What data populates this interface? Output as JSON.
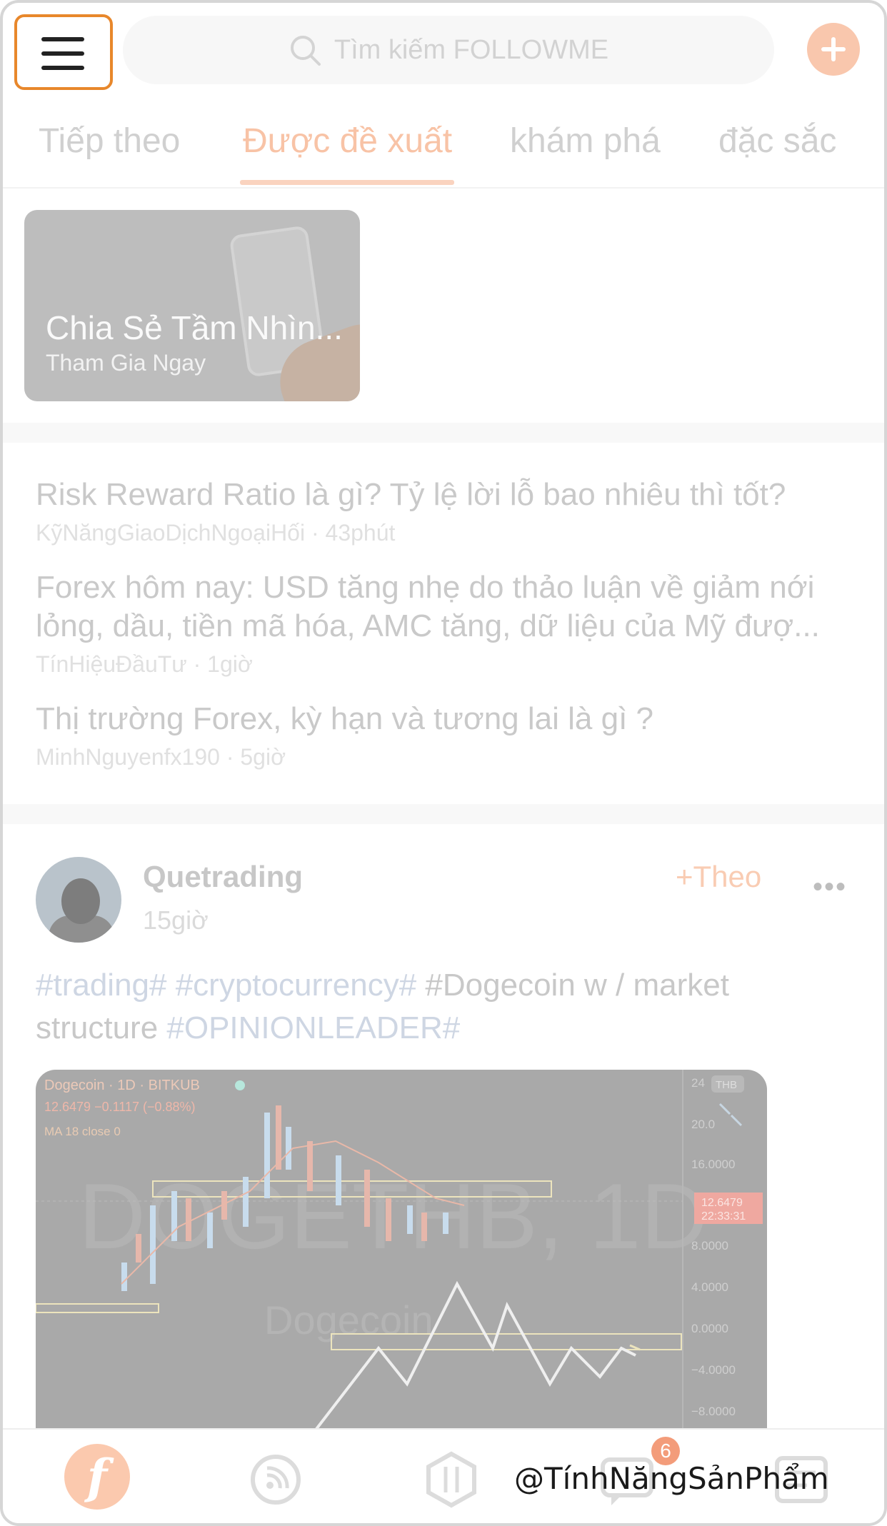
{
  "header": {
    "search_placeholder": "Tìm kiếm FOLLOWME"
  },
  "tabs": [
    {
      "label": "Tiếp theo",
      "active": false
    },
    {
      "label": "Được đề xuất",
      "active": true
    },
    {
      "label": "khám phá",
      "active": false
    },
    {
      "label": "đặc sắc",
      "active": false
    }
  ],
  "banner": {
    "title": "Chia Sẻ Tầm Nhìn...",
    "subtitle": "Tham Gia Ngay"
  },
  "articles": [
    {
      "title": "Risk Reward Ratio là gì? Tỷ lệ lời lỗ bao nhiêu thì tốt?",
      "author": "KỹNăngGiaoDịchNgoạiHối",
      "time": "43phút"
    },
    {
      "title_line1": "Forex hôm nay: USD tăng nhẹ do thảo luận về giảm nới",
      "title_line2": "lỏng, dầu, tiền mã hóa, AMC tăng, dữ liệu của Mỹ đượ...",
      "author": "TínHiệuĐầuTư",
      "time": "1giờ"
    },
    {
      "title": "Thị trường Forex, kỳ hạn và tương lai là gì ?",
      "author": "MinhNguyenfx190",
      "time": "5giờ"
    }
  ],
  "post": {
    "author": "Quetrading",
    "time": "15giờ",
    "follow_label": "+Theo",
    "more_label": "•••",
    "tags_line1": "#trading# #cryptocurrency#",
    "text_line1": " #Dogecoin w / market",
    "text_line2_plain": "structure ",
    "tags_line2": "#OPINIONLEADER#",
    "chart": {
      "symbol_line": "Dogecoin · 1D · BITKUB",
      "price_line": "12.6479 −0.1117 (−0.88%)",
      "ma_line": "MA 18 close 0",
      "currency": "THB",
      "watermark_main": "DOGETHB, 1D",
      "watermark_sub": "Dogecoin",
      "price_tag": "12.6479",
      "price_time": "22:33:31",
      "axis_labels": [
        "24",
        "20.0",
        "16.0000",
        "8.0000",
        "4.0000",
        "0.0000",
        "−4.0000",
        "−8.0000"
      ]
    }
  },
  "bottom_nav": {
    "logo_letter": "f",
    "badge_count": "6",
    "watermark": "@TínhNăngSảnPhẩm",
    "icons": [
      "followme-logo-icon",
      "feed-icon",
      "trade-icon",
      "message-icon",
      "profile-icon"
    ]
  },
  "colors": {
    "accent": "#f8c3a6",
    "highlight_border": "#e8872b",
    "badge": "#f39c7a"
  }
}
